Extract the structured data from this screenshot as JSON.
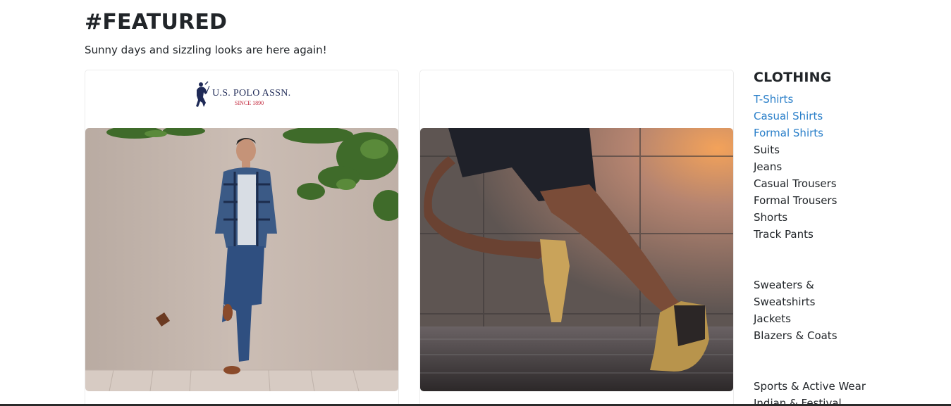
{
  "featured": {
    "title": "#FEATURED",
    "subtitle": "Sunny days and sizzling looks are here again!"
  },
  "cards": [
    {
      "brand": {
        "name": "U.S. POLO ASSN.",
        "tagline": "SINCE 1890"
      },
      "image": "man-leaning-on-wall-photo"
    },
    {
      "brand": null,
      "image": "runner-legs-photo"
    }
  ],
  "sidebar": {
    "heading": "CLOTHING",
    "groups": [
      [
        "T-Shirts",
        "Casual Shirts",
        "Formal Shirts",
        "Suits",
        "Jeans",
        "Casual Trousers",
        "Formal Trousers",
        "Shorts",
        "Track Pants"
      ],
      [
        "Sweaters &",
        "Sweatshirts",
        "Jackets",
        "Blazers & Coats"
      ],
      [
        "Sports & Active Wear",
        "Indian & Festival"
      ]
    ]
  },
  "colors": {
    "link": "#2a7fc9",
    "text": "#212529",
    "brand_navy": "#1f2a57",
    "brand_red": "#c2263b"
  }
}
